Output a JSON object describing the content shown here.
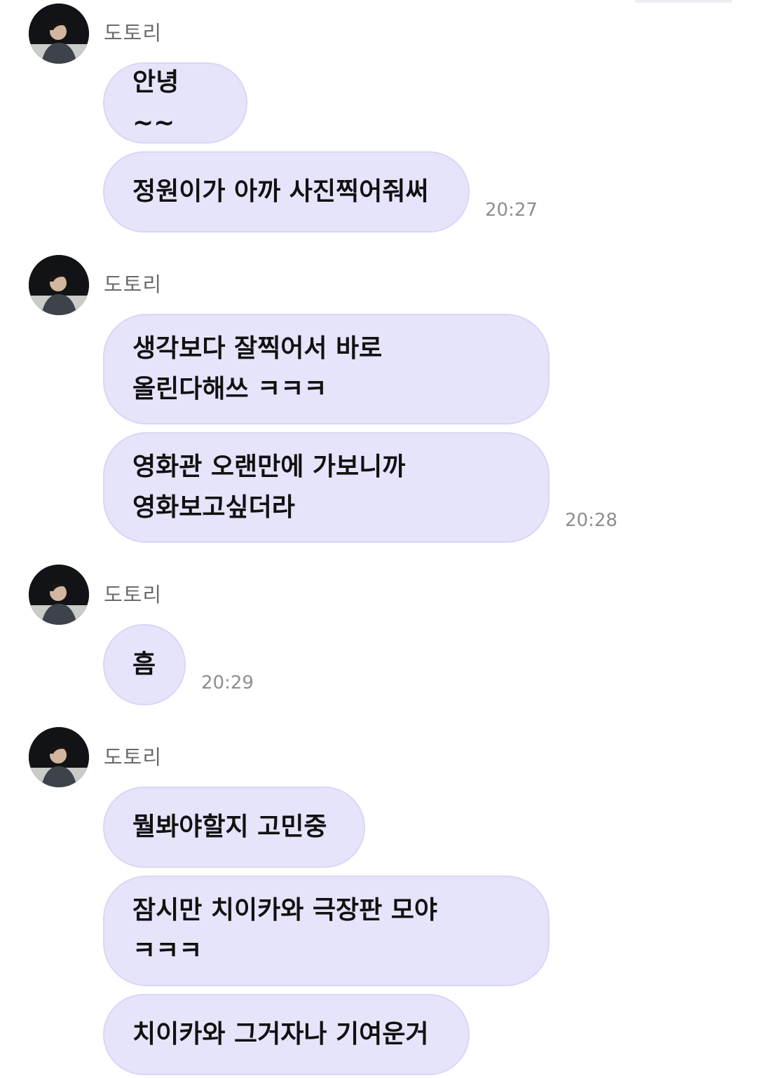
{
  "chat": {
    "groups": [
      {
        "sender": "도토리",
        "messages": [
          "안녕~~",
          "정원이가 아까 사진찍어줘써"
        ],
        "time": "20:27"
      },
      {
        "sender": "도토리",
        "messages": [
          "생각보다 잘찍어서 바로\n올린다해쓰 ㅋㅋㅋ",
          "영화관 오랜만에 가보니까\n영화보고싶더라"
        ],
        "time": "20:28"
      },
      {
        "sender": "도토리",
        "messages": [
          "흠"
        ],
        "time": "20:29"
      },
      {
        "sender": "도토리",
        "messages": [
          "뭘봐야할지 고민중",
          "잠시만 치이카와 극장판 모야\nㅋㅋㅋ",
          "치이카와 그거자나 기여운거"
        ]
      }
    ]
  },
  "colors": {
    "bubble_bg": "#e6e4fb",
    "bubble_border": "#d9d6f5",
    "sender_text": "#6b6b6b",
    "time_text": "#8e8e8e"
  },
  "icons": {
    "avatar": "profile-photo"
  }
}
